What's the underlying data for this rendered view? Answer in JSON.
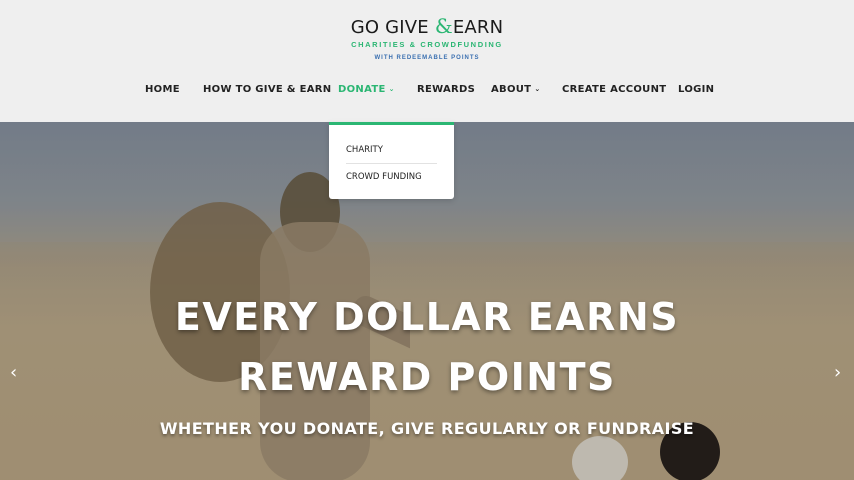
{
  "logo": {
    "title_pre": "GO GIVE ",
    "title_amp": "&",
    "title_post": "EARN",
    "subtitle": "CHARITIES & CROWDFUNDING",
    "subtitle2": "WITH REDEEMABLE POINTS"
  },
  "nav": {
    "items": [
      {
        "label": "HOME"
      },
      {
        "label": "HOW TO GIVE & EARN"
      },
      {
        "label": "DONATE"
      },
      {
        "label": "REWARDS"
      },
      {
        "label": "ABOUT"
      },
      {
        "label": "CREATE ACCOUNT"
      },
      {
        "label": "LOGIN"
      }
    ],
    "caret": "⌄"
  },
  "dropdown": {
    "items": [
      {
        "label": "CHARITY"
      },
      {
        "label": "CROWD FUNDING"
      }
    ]
  },
  "hero": {
    "headline_line1": "EVERY DOLLAR EARNS",
    "headline_line2": "REWARD POINTS",
    "subline": "WHETHER YOU DONATE, GIVE REGULARLY OR FUNDRAISE",
    "prev_arrow": "‹",
    "next_arrow": "›"
  },
  "colors": {
    "accent": "#2bb673",
    "link_blue": "#3a6fb0"
  }
}
